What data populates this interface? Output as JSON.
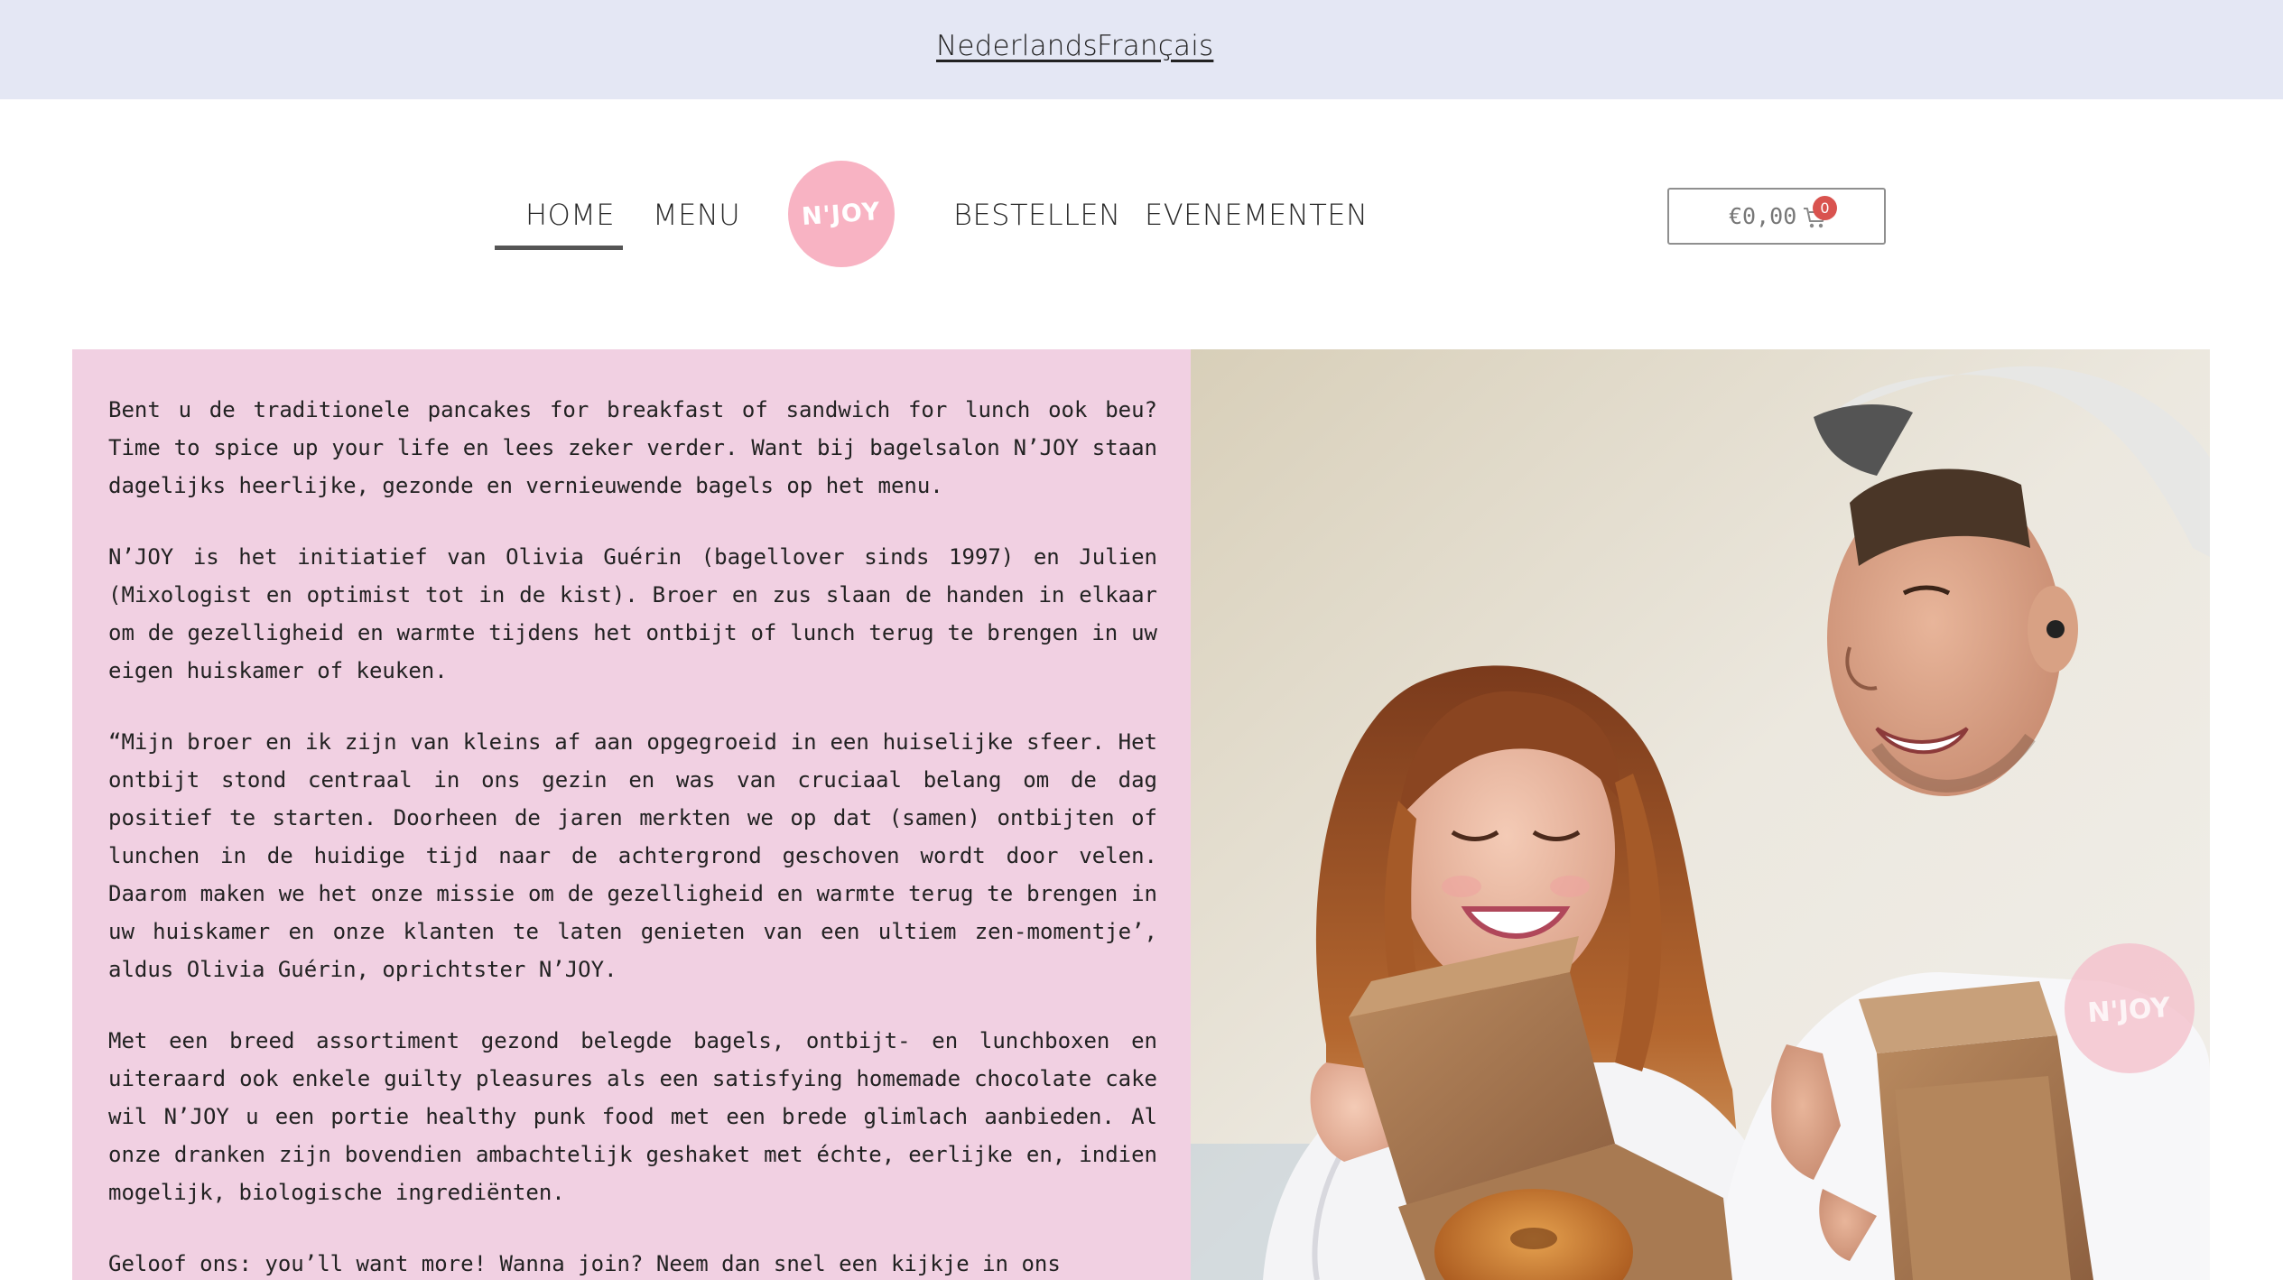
{
  "language_bar": {
    "dutch": "Nederlands",
    "french": "Français"
  },
  "nav": {
    "home": "HOME",
    "menu": "MENU",
    "logo_text": "N'JOY",
    "bestellen": "BESTELLEN",
    "evenementen": "EVENEMENTEN",
    "active_item": "HOME"
  },
  "cart": {
    "total": "€0,00",
    "count": "0",
    "icon": "shopping-cart-icon"
  },
  "content": {
    "paragraphs": [
      "Bent u de traditionele pancakes for breakfast of sandwich for lunch ook beu? Time to spice up your life en lees zeker verder. Want bij bagelsalon N’JOY staan dagelijks heerlijke, gezonde en vernieuwende bagels op het menu.",
      "N’JOY is het initiatief van Olivia Guérin (bagellover sinds 1997) en Julien (Mixologist en optimist tot in de kist). Broer en zus slaan de handen in elkaar om de gezelligheid en warmte tijdens het ontbijt of lunch terug te brengen in uw eigen huiskamer of keuken.",
      "“Mijn broer en ik zijn van kleins af aan opgegroeid in een huiselijke sfeer. Het ontbijt stond centraal in ons gezin en was van cruciaal belang om de dag positief te starten. Doorheen de jaren merkten we op dat (samen) ontbijten of lunchen in de huidige tijd naar de achtergrond geschoven wordt door velen. Daarom maken we het onze missie om de gezelligheid en warmte terug te brengen in uw huiskamer en onze klanten te laten genieten van een ultiem zen-momentje’, aldus Olivia Guérin, oprichtster N’JOY.",
      "Met een breed assortiment gezond belegde bagels, ontbijt- en lunchboxen en uiteraard ook enkele guilty pleasures als een satisfying homemade chocolate cake wil N’JOY u een portie healthy punk food met een brede glimlach aanbieden. Al onze dranken zijn bovendien ambachtelijk geshaket met échte, eerlijke en, indien mogelijk, biologische ingrediënten.",
      "Geloof ons: you’ll want more! Wanna join? Neem dan snel een kijkje in ons"
    ]
  },
  "photo": {
    "shirt_logo_text": "N'JOY"
  },
  "colors": {
    "language_bar_bg": "#e4e7f4",
    "text_panel_bg": "#f1d0e2",
    "logo_pink": "#f8b3c3",
    "badge_red": "#d9534f"
  }
}
